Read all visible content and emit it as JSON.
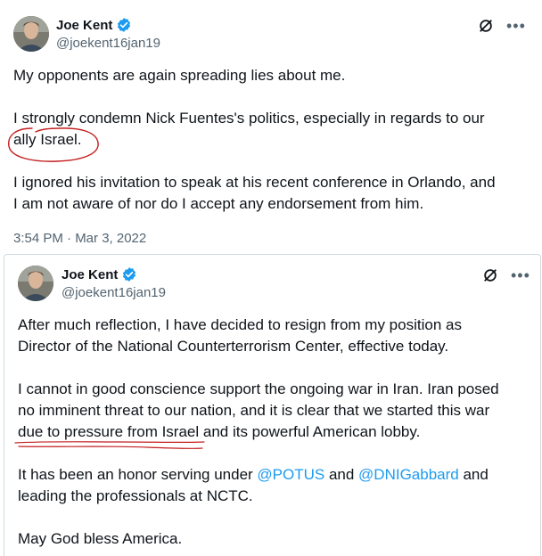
{
  "tweet1": {
    "author": {
      "name": "Joe Kent",
      "handle": "@joekent16jan19",
      "verified": true
    },
    "paragraph1": "My opponents are again spreading lies about me.",
    "paragraph2_line1": "I strongly condemn Nick Fuentes's politics, especially in regards to our",
    "paragraph2_line2": "ally Israel.",
    "paragraph3_line1": "I ignored his invitation to speak at his recent conference in Orlando, and",
    "paragraph3_line2": "I am not aware of nor do I accept any endorsement from him.",
    "timestamp": "3:54 PM · Mar 3, 2022",
    "icons": {
      "grok": "grok-slash-icon",
      "more": "more-icon"
    }
  },
  "tweet2": {
    "author": {
      "name": "Joe Kent",
      "handle": "@joekent16jan19",
      "verified": true
    },
    "paragraph1_line1": "After much reflection, I have decided to resign from my position as",
    "paragraph1_line2": "Director of the National Counterterrorism Center, effective today.",
    "paragraph2_line1": "I cannot in good conscience support the ongoing war in Iran. Iran posed",
    "paragraph2_line2": "no imminent threat to our nation, and it is clear that we started this war",
    "paragraph2_line3": "due to pressure from Israel and its powerful American lobby.",
    "paragraph3_line1_pre": "It has been an honor serving under ",
    "paragraph3_mention1": "@POTUS",
    "paragraph3_line1_mid": " and ",
    "paragraph3_mention2": "@DNIGabbard",
    "paragraph3_line1_post": " and",
    "paragraph3_line2": "leading the professionals at NCTC.",
    "paragraph4": "May God bless America.",
    "icons": {
      "grok": "grok-slash-icon",
      "more": "more-icon"
    }
  },
  "colors": {
    "text": "#0f1419",
    "secondary": "#536471",
    "link": "#1d9bf0",
    "verified": "#1d9bf0",
    "annotation": "#c41e1e",
    "border": "#cfd9de"
  }
}
